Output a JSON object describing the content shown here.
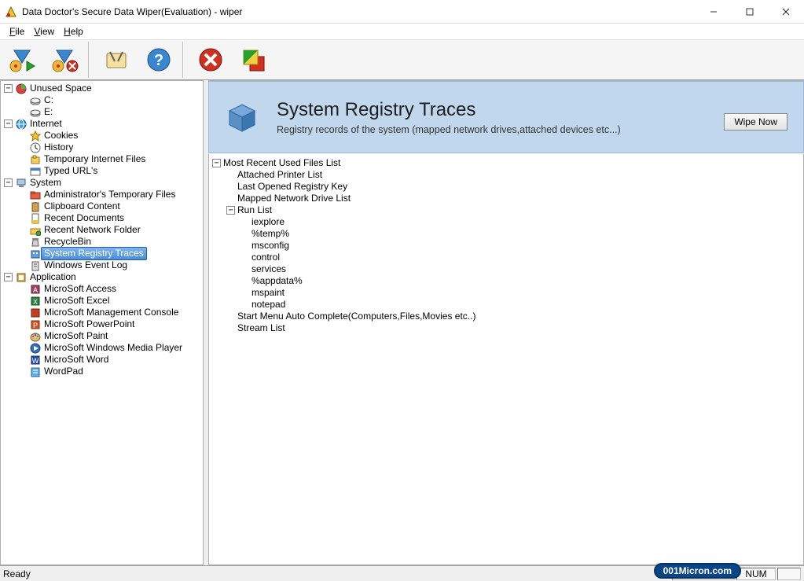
{
  "window": {
    "title": "Data Doctor's Secure Data Wiper(Evaluation) - wiper"
  },
  "menubar": {
    "file": "File",
    "view": "View",
    "help": "Help"
  },
  "tree": {
    "root": [
      {
        "label": "Unused Space",
        "icon": "disk-pie-icon",
        "children": [
          {
            "label": "C:",
            "icon": "drive-icon"
          },
          {
            "label": "E:",
            "icon": "drive-icon"
          }
        ]
      },
      {
        "label": "Internet",
        "icon": "globe-icon",
        "children": [
          {
            "label": "Cookies",
            "icon": "star-icon"
          },
          {
            "label": "History",
            "icon": "clock-icon"
          },
          {
            "label": "Temporary Internet Files",
            "icon": "temp-icon"
          },
          {
            "label": "Typed URL's",
            "icon": "url-icon"
          }
        ]
      },
      {
        "label": "System",
        "icon": "computer-icon",
        "children": [
          {
            "label": "Administrator's Temporary Files",
            "icon": "folder-red-icon"
          },
          {
            "label": "Clipboard Content",
            "icon": "clipboard-icon"
          },
          {
            "label": "Recent Documents",
            "icon": "recent-doc-icon"
          },
          {
            "label": "Recent Network Folder",
            "icon": "network-folder-icon"
          },
          {
            "label": "RecycleBin",
            "icon": "recycle-icon"
          },
          {
            "label": "System Registry Traces",
            "icon": "registry-icon",
            "selected": true
          },
          {
            "label": "Windows Event Log",
            "icon": "eventlog-icon"
          }
        ]
      },
      {
        "label": "Application",
        "icon": "app-icon",
        "children": [
          {
            "label": "MicroSoft Access",
            "icon": "access-icon"
          },
          {
            "label": "MicroSoft Excel",
            "icon": "excel-icon"
          },
          {
            "label": "MicroSoft Management Console",
            "icon": "mmc-icon"
          },
          {
            "label": "MicroSoft PowerPoint",
            "icon": "ppt-icon"
          },
          {
            "label": "MicroSoft Paint",
            "icon": "paint-icon"
          },
          {
            "label": "MicroSoft Windows Media Player",
            "icon": "wmp-icon"
          },
          {
            "label": "MicroSoft Word",
            "icon": "word-icon"
          },
          {
            "label": "WordPad",
            "icon": "wordpad-icon"
          }
        ]
      }
    ]
  },
  "banner": {
    "title": "System Registry Traces",
    "subtitle": "Registry records of the system (mapped network drives,attached devices etc...)",
    "button": "Wipe Now"
  },
  "detail": {
    "root_label": "Most Recent Used Files List",
    "items": [
      "Attached Printer List",
      "Last Opened Registry Key",
      "Mapped Network Drive List"
    ],
    "runlist": {
      "label": "Run List",
      "items": [
        "iexplore",
        "%temp%",
        "msconfig",
        "control",
        "services",
        "%appdata%",
        "mspaint",
        "notepad"
      ]
    },
    "after": [
      "Start Menu Auto Complete(Computers,Files,Movies etc..)",
      "Stream List"
    ]
  },
  "statusbar": {
    "ready": "Ready",
    "num": "NUM"
  },
  "watermark": "001Micron.com",
  "toolbar_icons": [
    "wipe-play-icon",
    "wipe-cancel-icon",
    "settings-icon",
    "help-icon",
    "error-icon",
    "layers-icon"
  ]
}
